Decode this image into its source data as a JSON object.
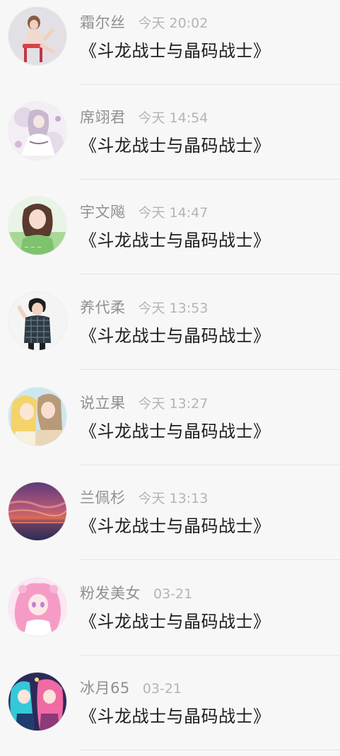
{
  "comments": [
    {
      "user": "霜尔丝",
      "time": "今天 20:02",
      "text": "《斗龙战士与晶码战士》",
      "avatar": "avatar-woman-red-chair",
      "avatar_colors": [
        "#e9e7ea",
        "#d8404a",
        "#f1cfc0"
      ]
    },
    {
      "user": "席翊君",
      "time": "今天 14:54",
      "text": "《斗龙战士与晶码战士》",
      "avatar": "avatar-anime-white-dress",
      "avatar_colors": [
        "#f3eef3",
        "#c7b8cf",
        "#8c6f8f"
      ]
    },
    {
      "user": "宇文飚",
      "time": "今天 14:47",
      "text": "《斗龙战士与晶码战士》",
      "avatar": "avatar-girl-green",
      "avatar_colors": [
        "#eaf4e6",
        "#7fc26d",
        "#5a3a2e"
      ]
    },
    {
      "user": "养代柔",
      "time": "今天 13:53",
      "text": "《斗龙战士与晶码战士》",
      "avatar": "avatar-boy-plaid",
      "avatar_colors": [
        "#f4f4f4",
        "#2c3b45",
        "#1e1e1e"
      ]
    },
    {
      "user": "说立果",
      "time": "今天 13:27",
      "text": "《斗龙战士与晶码战士》",
      "avatar": "avatar-anime-couple",
      "avatar_colors": [
        "#cde7ef",
        "#f4d36b",
        "#b89a78"
      ]
    },
    {
      "user": "兰佩杉",
      "time": "今天 13:13",
      "text": "《斗龙战士与晶码战士》",
      "avatar": "avatar-sunset-sea",
      "avatar_colors": [
        "#5e3b77",
        "#d96a57",
        "#2b2d55"
      ]
    },
    {
      "user": "粉发美女",
      "time": "03-21",
      "text": "《斗龙战士与晶码战士》",
      "avatar": "avatar-pink-hair-anime",
      "avatar_colors": [
        "#fbe6f2",
        "#f49cc6",
        "#c67fd6"
      ]
    },
    {
      "user": "冰月65",
      "time": "03-21",
      "text": "《斗龙战士与晶码战士》",
      "avatar": "avatar-anime-duo",
      "avatar_colors": [
        "#2c2a5a",
        "#35c8d8",
        "#f06aa4"
      ]
    }
  ]
}
